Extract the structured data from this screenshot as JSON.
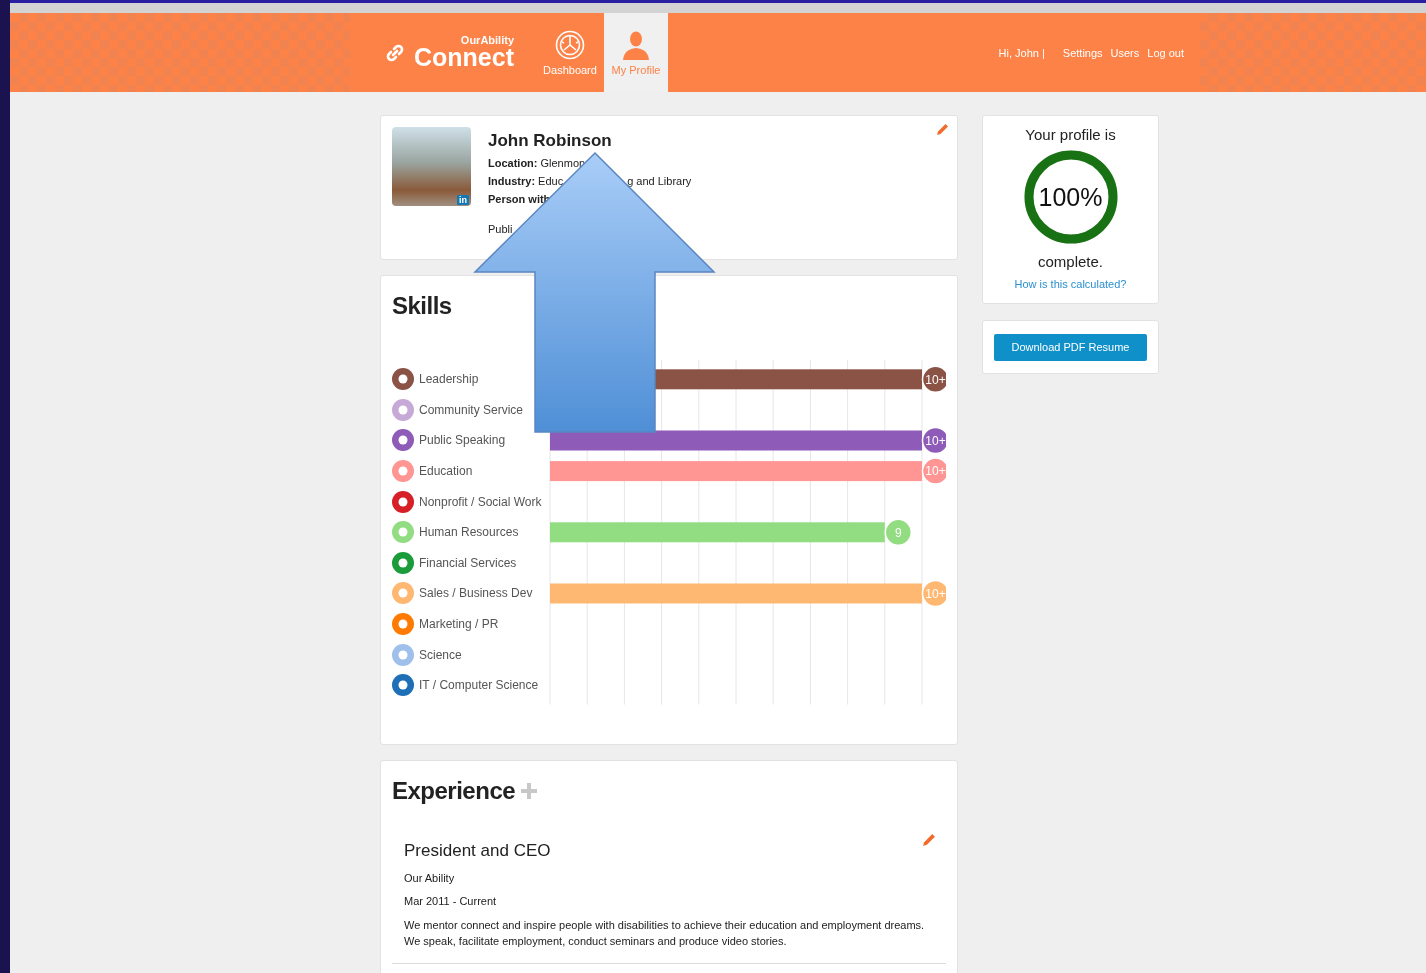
{
  "header": {
    "logo": {
      "small": "OurAbility",
      "large": "Connect"
    },
    "nav": [
      {
        "label": "Dashboard",
        "kind": "gauge",
        "selected": false
      },
      {
        "label": "My Profile",
        "kind": "person",
        "selected": true
      }
    ],
    "greeting": "Hi, John |",
    "links": [
      "Settings",
      "Users",
      "Log out"
    ]
  },
  "profile": {
    "badge": "in",
    "name": "John Robinson",
    "lines": [
      {
        "label": "Location:",
        "parts": [
          "Glenmon"
        ]
      },
      {
        "label": "Industry:",
        "parts": [
          "Educ",
          "g and Library"
        ]
      },
      {
        "label": "Person with"
      },
      {
        "parts": [
          "Publi"
        ]
      }
    ]
  },
  "skills": {
    "title": "Skills",
    "items": [
      {
        "color": "#8b5346"
      },
      {
        "color": "#c7a9d8"
      },
      {
        "color": "#8e5bb8"
      },
      {
        "color": "#ff9694"
      },
      {
        "color": "#d61f26"
      },
      {
        "color": "#92dc82"
      },
      {
        "color": "#1a9c3a"
      },
      {
        "color": "#ffb872"
      },
      {
        "color": "#ff7a00"
      },
      {
        "color": "#9ec0ea"
      },
      {
        "color": "#1f6fb6"
      }
    ],
    "chart_data": {
      "type": "bar",
      "orientation": "horizontal",
      "xlim": [
        0,
        10
      ],
      "categories": [
        "Leadership",
        "Community Service",
        "Public Speaking",
        "Education",
        "Nonprofit / Social Work",
        "Human Resources",
        "Financial Services",
        "Sales / Business Dev",
        "Marketing / PR",
        "Science",
        "IT / Computer Science"
      ],
      "values": [
        10,
        null,
        10,
        10,
        null,
        9,
        null,
        10,
        null,
        null,
        null
      ],
      "value_labels": [
        "10+",
        null,
        "10+",
        "10+",
        null,
        "9",
        null,
        "10+",
        null,
        null,
        null
      ]
    }
  },
  "completion": {
    "heading": "Your profile is",
    "level": 1,
    "percent": "100%",
    "suffix": "complete.",
    "link": "How is this calculated?"
  },
  "download_button": "Download PDF Resume",
  "experience": {
    "title": "Experience",
    "entries": [
      {
        "role": "President and CEO",
        "company": "Our Ability",
        "dates": "Mar 2011 - Current",
        "description": "We mentor connect and inspire people with disabilities to achieve their education and employment dreams. We speak, facilitate employment, conduct seminars and produce video stories."
      }
    ]
  }
}
